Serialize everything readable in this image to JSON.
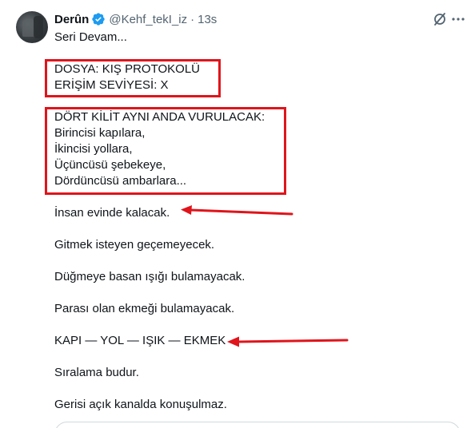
{
  "post": {
    "author_name": "Derûn",
    "handle": "@Kehf_tekI_iz",
    "separator": "·",
    "time": "13s",
    "lines": [
      "Seri Devam...",
      "DOSYA: KIŞ PROTOKOLÜ",
      "ERİŞİM SEVİYESİ: X",
      "DÖRT KİLİT AYNI ANDA VURULACAK:",
      "Birincisi kapılara,",
      "İkincisi yollara,",
      "Üçüncüsü şebekeye,",
      "Dördüncüsü ambarlara...",
      "İnsan evinde kalacak.",
      "Gitmek isteyen geçemeyecek.",
      "Düğmeye basan ışığı bulamayacak.",
      "Parası olan ekmeği bulamayacak.",
      "KAPI — YOL — IŞIK — EKMEK",
      "Sıralama budur.",
      "Gerisi açık kanalda konuşulmaz."
    ]
  },
  "icons": {
    "verified": "verified-badge-icon",
    "grok": "grok-icon",
    "more": "more-icon"
  },
  "colors": {
    "annotation_red": "#e0141b",
    "verified_blue": "#1d9bf0",
    "text": "#0f1419",
    "muted": "#536471"
  }
}
